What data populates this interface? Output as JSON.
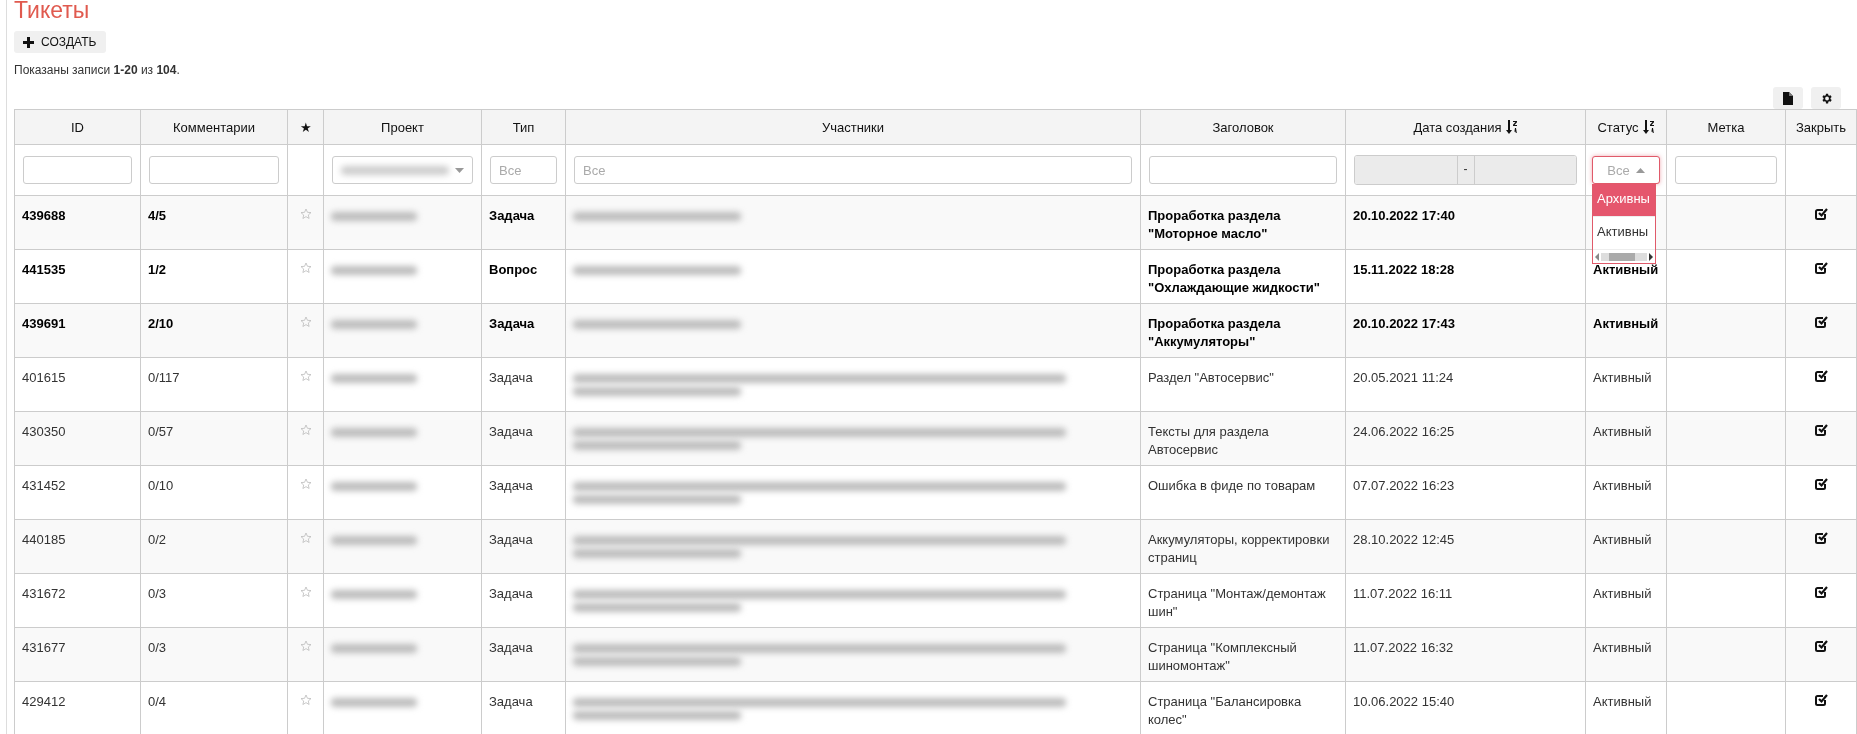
{
  "title": "Тикеты",
  "create_button": {
    "label": "СОЗДАТЬ"
  },
  "summary": "Показаны записи **1-20** из **104**.",
  "table": {
    "columns": [
      {
        "label": "ID",
        "sorted": false
      },
      {
        "label": "Комментарии",
        "sorted": false
      },
      {
        "label": "★",
        "sorted": false
      },
      {
        "label": "Проект",
        "sorted": false
      },
      {
        "label": "Тип",
        "sorted": false
      },
      {
        "label": "Участники",
        "sorted": false
      },
      {
        "label": "Заголовок",
        "sorted": false
      },
      {
        "label": "Дата создания",
        "sorted": true
      },
      {
        "label": "Статус",
        "sorted": true
      },
      {
        "label": "Метка",
        "sorted": false
      },
      {
        "label": "Закрыть",
        "sorted": false
      }
    ],
    "filters": [
      {
        "kind": "text"
      },
      {
        "kind": "text"
      },
      {
        "kind": "none"
      },
      {
        "kind": "select",
        "value_blurred": true,
        "open": false
      },
      {
        "kind": "text",
        "placeholder": "Все"
      },
      {
        "kind": "text",
        "placeholder": "Все"
      },
      {
        "kind": "text"
      },
      {
        "kind": "range",
        "separator": "-",
        "disabled": true
      },
      {
        "kind": "select",
        "value": "Все",
        "open": true,
        "options": [
          {
            "label": "Архивны",
            "selected": true
          },
          {
            "label": "Активны",
            "selected": false
          }
        ]
      },
      {
        "kind": "text"
      },
      {
        "kind": "none"
      }
    ],
    "rows": [
      {
        "id": "439688",
        "comments": "4/5",
        "starred": false,
        "type": "Задача",
        "title": "Проработка раздела \"Моторное масло\"",
        "created": "20.10.2022 17:40",
        "unread": true
      },
      {
        "id": "441535",
        "comments": "1/2",
        "starred": false,
        "type": "Вопрос",
        "title": "Проработка раздела \"Охлаждающие жидкости\"",
        "created": "15.11.2022 18:28",
        "status": "Активный",
        "unread": true
      },
      {
        "id": "439691",
        "comments": "2/10",
        "starred": false,
        "type": "Задача",
        "title": "Проработка раздела \"Аккумуляторы\"",
        "created": "20.10.2022 17:43",
        "status": "Активный",
        "unread": true
      },
      {
        "id": "401615",
        "comments": "0/117",
        "starred": false,
        "type": "Задача",
        "title": "Раздел \"Автосервис\"",
        "created": "20.05.2021 11:24",
        "status": "Активный",
        "unread": false
      },
      {
        "id": "430350",
        "comments": "0/57",
        "starred": false,
        "type": "Задача",
        "title": "Тексты для раздела Автосервис",
        "created": "24.06.2022 16:25",
        "status": "Активный",
        "unread": false
      },
      {
        "id": "431452",
        "comments": "0/10",
        "starred": false,
        "type": "Задача",
        "title": "Ошибка в фиде по товарам",
        "created": "07.07.2022 16:23",
        "status": "Активный",
        "unread": false
      },
      {
        "id": "440185",
        "comments": "0/2",
        "starred": false,
        "type": "Задача",
        "title": "Аккумуляторы, корректировки страниц",
        "created": "28.10.2022 12:45",
        "status": "Активный",
        "unread": false
      },
      {
        "id": "431672",
        "comments": "0/3",
        "starred": false,
        "type": "Задача",
        "title": "Страница \"Монтаж/демонтаж шин\"",
        "created": "11.07.2022 16:11",
        "status": "Активный",
        "unread": false
      },
      {
        "id": "431677",
        "comments": "0/3",
        "starred": false,
        "type": "Задача",
        "title": "Страница \"Комплексный шиномонтаж\"",
        "created": "11.07.2022 16:32",
        "status": "Активный",
        "unread": false
      },
      {
        "id": "429412",
        "comments": "0/4",
        "starred": false,
        "type": "Задача",
        "title": "Страница \"Балансировка колес\"",
        "created": "10.06.2022 15:40",
        "status": "Активный",
        "unread": false
      }
    ]
  }
}
